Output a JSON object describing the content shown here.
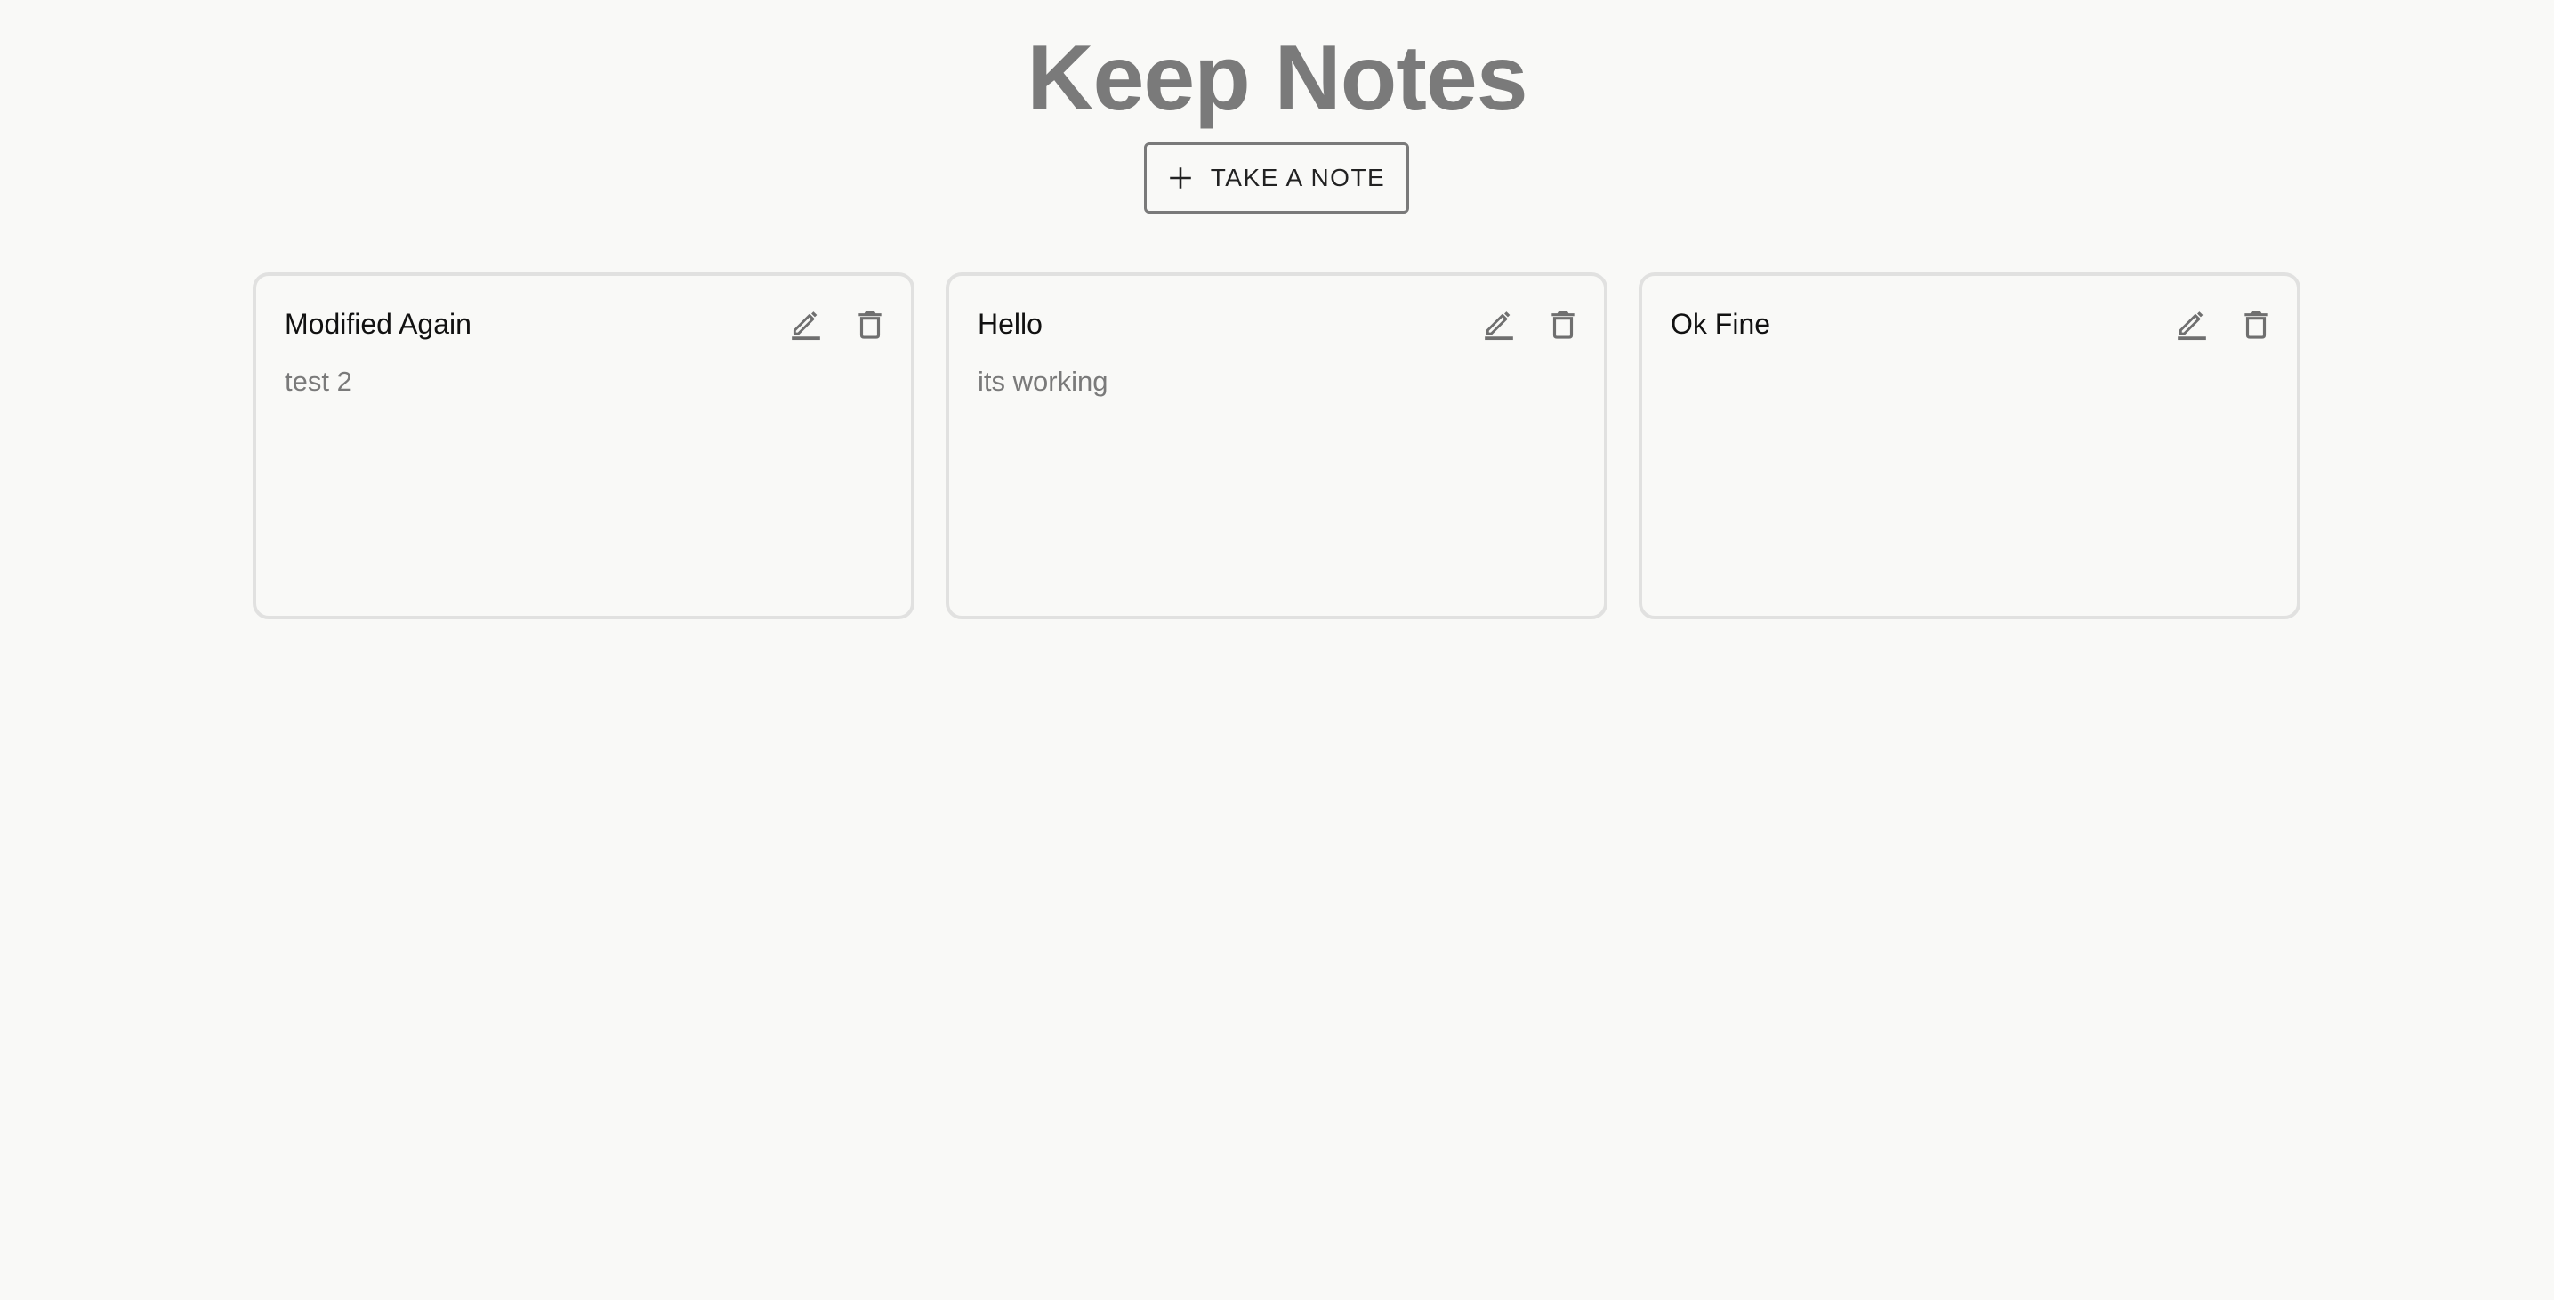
{
  "header": {
    "title": "Keep Notes",
    "take_note_label": "TAKE A NOTE"
  },
  "icons": {
    "add": "plus-icon",
    "edit": "pencil-icon",
    "delete": "trash-icon"
  },
  "colors": {
    "background": "#f9f9f7",
    "title": "#7a7a7a",
    "card_border": "#e1e1e0",
    "icon": "#6f6f6f"
  },
  "notes": [
    {
      "title": "Modified Again",
      "body": "test 2"
    },
    {
      "title": "Hello",
      "body": "its working"
    },
    {
      "title": "Ok Fine",
      "body": ""
    }
  ]
}
